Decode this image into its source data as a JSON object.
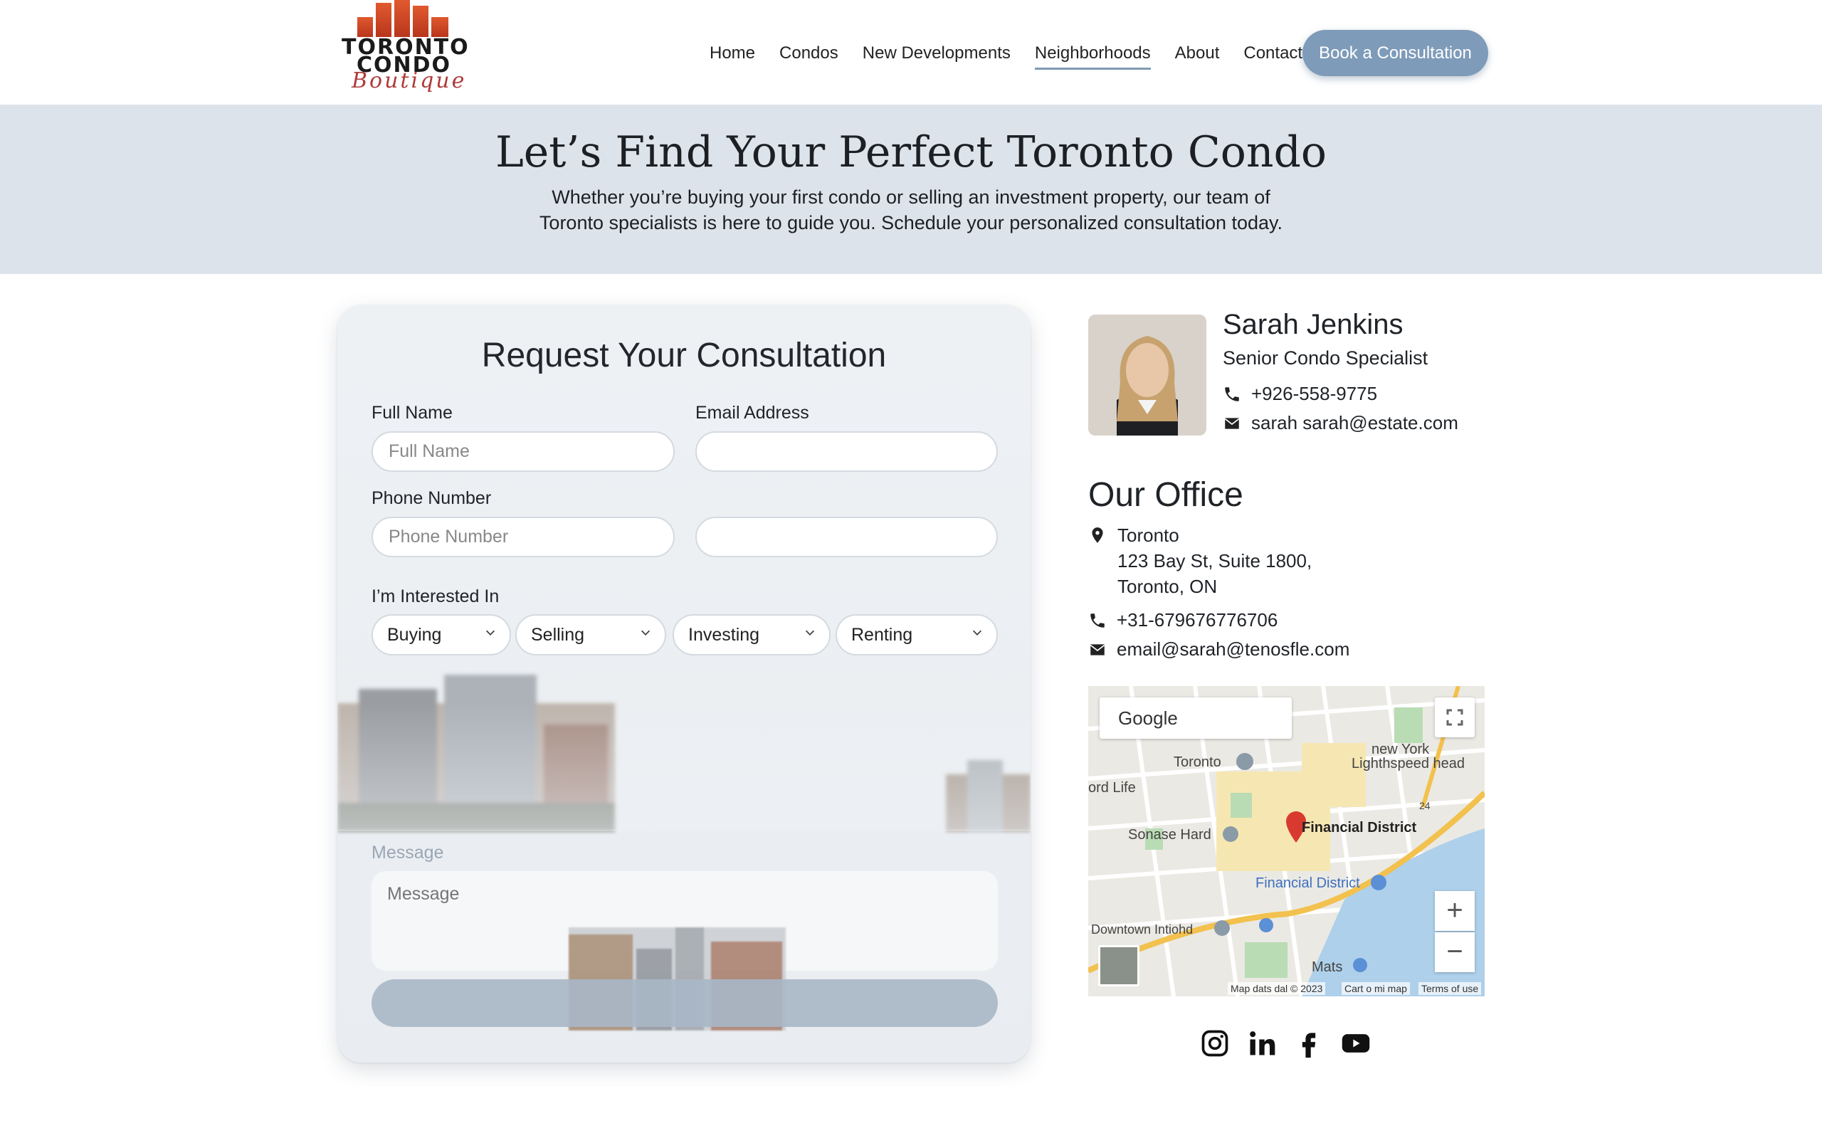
{
  "brand": {
    "line1": "TORONTO",
    "line2": "CONDO",
    "script": "Boutique"
  },
  "nav": {
    "items": [
      "Home",
      "Condos",
      "New Developments",
      "Neighborhoods",
      "About",
      "Contact"
    ],
    "active": "Neighborhoods",
    "cta": "Book a Consultation"
  },
  "hero": {
    "title": "Let’s Find Your Perfect Toronto Condo",
    "subtitle": "Whether you’re buying your first condo or selling an investment property, our team of Toronto specialists is here to guide you. Schedule your personalized consultation today."
  },
  "form": {
    "title": "Request Your Consultation",
    "full_name_label": "Full Name",
    "full_name_placeholder": "Full Name",
    "email_label": "Email Address",
    "email_value": "",
    "phone_label": "Phone Number",
    "phone_placeholder": "Phone Number",
    "extra_value": "",
    "interest_label": "I’m Interested In",
    "selects": [
      "Buying",
      "Selling",
      "Investing",
      "Renting"
    ],
    "message_label": "Message",
    "message_placeholder": "Message"
  },
  "agent": {
    "name": "Sarah Jenkins",
    "role": "Senior Condo Specialist",
    "phone": "+926-558-9775",
    "email": "sarah sarah@estate.com"
  },
  "office": {
    "title": "Our Office",
    "city": "Toronto",
    "street": "123 Bay St, Suite 1800,",
    "region": "Toronto, ON",
    "phone": "+31-679676776706",
    "email": "email@sarah@tenosfle.com"
  },
  "map": {
    "brand": "Google",
    "labels": {
      "toronto": "Toronto",
      "newyork": "new York",
      "lightspeed": "Lighthspeed head",
      "ordlife": "ord Life",
      "sonase": "Sonase Hard",
      "financial1": "Financial District",
      "financial2": "Financial District",
      "downtown": "Downtown Intiohd",
      "mats": "Mats",
      "s24": "24"
    },
    "footer": {
      "data": "Map dats dal © 2023",
      "carto": "Cart o mi map",
      "terms": "Terms of use"
    }
  },
  "social": [
    "instagram-icon",
    "linkedin-icon",
    "facebook-icon",
    "youtube-icon"
  ],
  "colors": {
    "accent": "#7e9bb9",
    "hero_bg": "#dde3ea",
    "logo_red": "#d2482a",
    "pin_red": "#d93a2f"
  }
}
